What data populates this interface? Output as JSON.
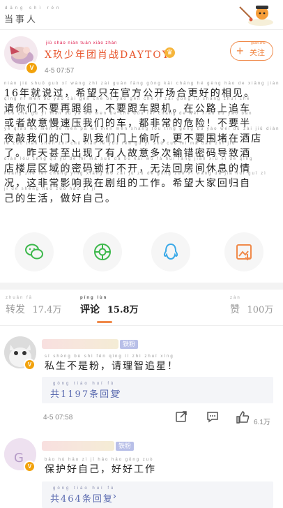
{
  "topbar": {
    "title": "当事人",
    "title_pinyin": "dāng shì rén"
  },
  "post": {
    "author": "X玖少年团肖战DAYTOY",
    "author_pinyin": "jiǔ shào nián tuán xiào zhàn",
    "time": "4-5 07:57",
    "follow_label": "关注",
    "follow_pinyin": "guān zhù",
    "lines": [
      {
        "pinyin": "nián jiù shuō guò    xī wàng zhǐ zài guān fāng gōng kāi chǎng hé gèng hǎo de xiāng jiàn",
        "text": "16年就说过，希望只在官方公开场合更好的相见。"
      },
      {
        "pinyin": "qǐng nǐ men bú yào zài gēn chē   bú yào gēn chē jī   zài gōng lù shàng zhuī chē",
        "text": "请你们不要再跟组，不要跟车跟机。在公路上追车"
      },
      {
        "pinyin": "huò zhě gù yì màn sù yā wǒ men de chē   dōu fēi cháng de wēi xiǎn   bú yào bàn",
        "text": "或者故意慢速压我们的车，都非常的危险！不要半"
      },
      {
        "pinyin": "yè qiāo wǒ men de mén   pā wǒ men mén shàng tōu tīng   gèng bú yào wéi dǔ zài jiǔ diàn",
        "text": "夜敲我们的门、趴我们门上偷听，更不要围堵在酒店"
      },
      {
        "pinyin": "le   zuó tiān shèn zhì chū xiàn le yǒu rén gù yì shū cuò mì mǎ dǎo zhì jiǔ",
        "text": "了。昨天甚至出现了有人故意多次输错密码导致酒"
      },
      {
        "pinyin": "diàn lóu céng qū yù de mì mǎ suǒ dǎ bù kāi   wú fǎ huí fáng jiān xiū xi de qíng",
        "text": "店楼层区域的密码锁打不开，无法回房间休息的情"
      },
      {
        "pinyin": "kuàng   zhè fēi cháng yǐng xiǎng wǒ zài jù zǔ de gōng zuò   xī wàng dà jiā huí guī zì",
        "text": "况，这非常影响我在剧组的工作。希望大家回归自"
      },
      {
        "pinyin": "jǐ de shēng huó   zuò hǎo zì jǐ",
        "text": "己的生活，做好自己。"
      }
    ]
  },
  "share": [
    {
      "icon": "wechat-icon"
    },
    {
      "icon": "moments-icon"
    },
    {
      "icon": "qq-icon"
    },
    {
      "icon": "save-image-icon"
    }
  ],
  "tabs": {
    "repost": {
      "label": "转发",
      "pinyin": "zhuǎn fā",
      "count": "17.4",
      "unit": "万",
      "unit_pinyin": "wàn"
    },
    "comment": {
      "label": "评论",
      "pinyin": "píng lùn",
      "count": "15.8",
      "unit": "万",
      "unit_pinyin": "wàn"
    },
    "like": {
      "label": "赞",
      "pinyin": "zàn",
      "count": "100",
      "unit": "万",
      "unit_pinyin": "wàn"
    }
  },
  "comments": [
    {
      "fan_badge": "铁粉",
      "text": "私生不是粉，请理智追星！",
      "pinyin": "sī shēng bù shì fěn   qǐng lǐ zhì zhuī xīng",
      "reply_summary": "共1197条回复",
      "reply_pinyin": "gòng tiáo huí fù",
      "time": "4-5 07:58",
      "likes": "6.1万"
    },
    {
      "fan_badge": "铁粉",
      "text": "保护好自己，好好工作",
      "pinyin": "bǎo hù hǎo zì jǐ   hǎo hǎo gōng zuò",
      "reply_summary": "共464条回复",
      "reply_pinyin": "gòng tiáo huí fù"
    }
  ],
  "colors": {
    "accent": "#f08a4a",
    "author": "#e8552c",
    "link": "#5b6bb0",
    "vip": "#f2a20c"
  }
}
